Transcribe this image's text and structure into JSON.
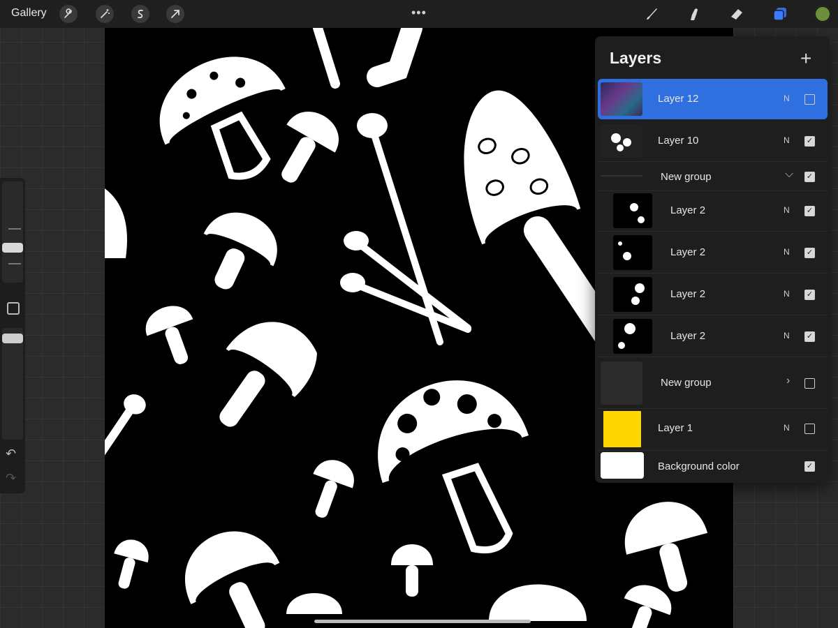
{
  "topbar": {
    "gallery_label": "Gallery",
    "left_tools": [
      "wrench-icon",
      "magic-wand-icon",
      "selection-s-icon",
      "transform-arrow-icon"
    ],
    "more_label": "•••",
    "right_tools": [
      "brush-icon",
      "smudge-icon",
      "eraser-icon",
      "layers-icon"
    ],
    "active_tool": "layers-icon",
    "active_color": "#6b8f3a",
    "accent": "#3a7bff"
  },
  "layers": {
    "title": "Layers",
    "add_label": "+",
    "items": [
      {
        "name": "Layer 12",
        "blend": "N",
        "visible": false,
        "selected": true
      },
      {
        "name": "Layer 10",
        "blend": "N",
        "visible": true
      },
      {
        "name": "New group",
        "visible": true,
        "group": true,
        "expanded": true
      },
      {
        "name": "Layer 2",
        "blend": "N",
        "visible": true
      },
      {
        "name": "Layer 2",
        "blend": "N",
        "visible": true
      },
      {
        "name": "Layer 2",
        "blend": "N",
        "visible": true
      },
      {
        "name": "Layer 2",
        "blend": "N",
        "visible": true
      },
      {
        "name": "New group",
        "visible": false,
        "group": true,
        "expanded": false
      },
      {
        "name": "Layer 1",
        "blend": "N",
        "visible": false,
        "thumb_color": "#ffd600"
      },
      {
        "name": "Background color",
        "visible": true,
        "thumb_color": "#ffffff"
      }
    ]
  }
}
